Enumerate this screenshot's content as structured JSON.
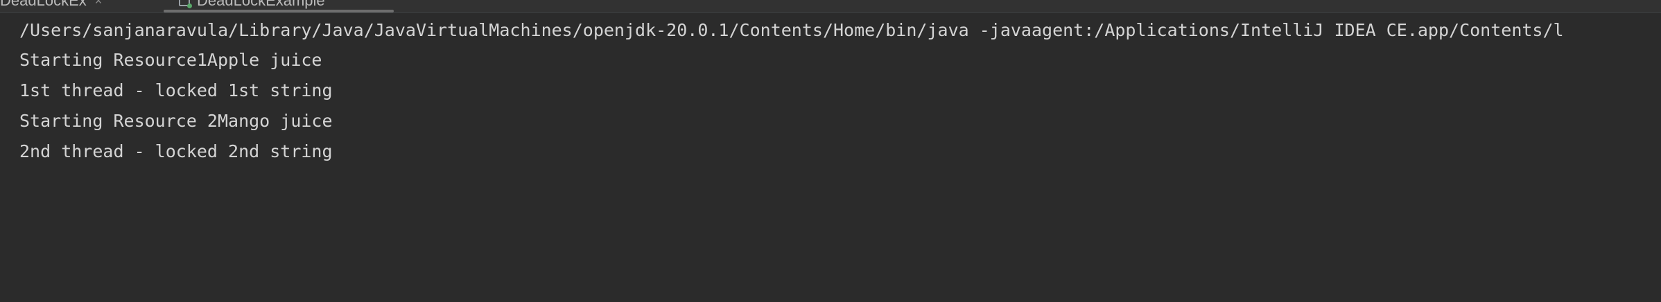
{
  "tabs": [
    {
      "label": "DeadLockEx",
      "close": "×"
    },
    {
      "label": "DeadLockExample"
    }
  ],
  "console": {
    "lines": [
      "/Users/sanjanaravula/Library/Java/JavaVirtualMachines/openjdk-20.0.1/Contents/Home/bin/java -javaagent:/Applications/IntelliJ IDEA CE.app/Contents/l",
      "Starting Resource1Apple juice",
      "1st thread - locked 1st string",
      "Starting Resource 2Mango juice",
      "2nd thread - locked 2nd string"
    ]
  },
  "colors": {
    "background": "#2b2b2b",
    "text": "#d4d4d4",
    "run_indicator": "#59a869"
  },
  "icons": {
    "tab_1": "run-config-icon",
    "tab_2": "run-config-icon"
  }
}
